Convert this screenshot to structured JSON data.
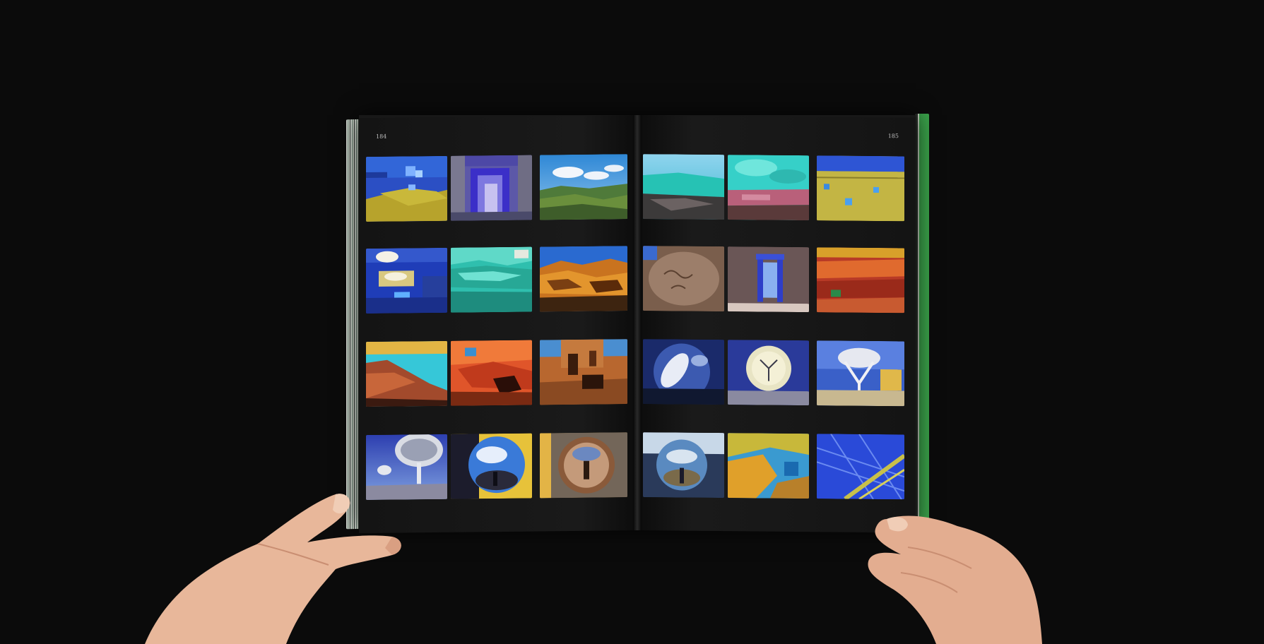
{
  "pages": {
    "left_number": "184",
    "right_number": "185"
  },
  "photo_grid": {
    "left_page": [
      [
        "photo-blue-wall-yellow-sand",
        "photo-blue-window-stone-frame",
        "photo-blue-sky-green-hills"
      ],
      [
        "photo-clouds-blue-window",
        "photo-turquoise-rock-wall",
        "photo-orange-cliffs"
      ],
      [
        "photo-red-rock-cyan-sky",
        "photo-orange-red-rock",
        "photo-ruins-orange-stone"
      ],
      [
        "photo-radio-telescope-dish",
        "photo-mirror-sphere-sky",
        "photo-mirror-sphere-reflection"
      ]
    ],
    "right_page": [
      [
        "photo-cyan-cliffs-rock",
        "photo-turquoise-sky-rocks",
        "photo-yellow-wall-blue-sky"
      ],
      [
        "photo-petroglyph-rock",
        "photo-blue-doorway-ruin",
        "photo-red-canyon"
      ],
      [
        "photo-telescope-dish-mirror",
        "photo-telescope-dish-front",
        "photo-telescope-structure"
      ],
      [
        "photo-mirror-sphere-canyon",
        "photo-yellow-tree-blue-sky",
        "photo-blue-telescope-lattice"
      ]
    ]
  }
}
